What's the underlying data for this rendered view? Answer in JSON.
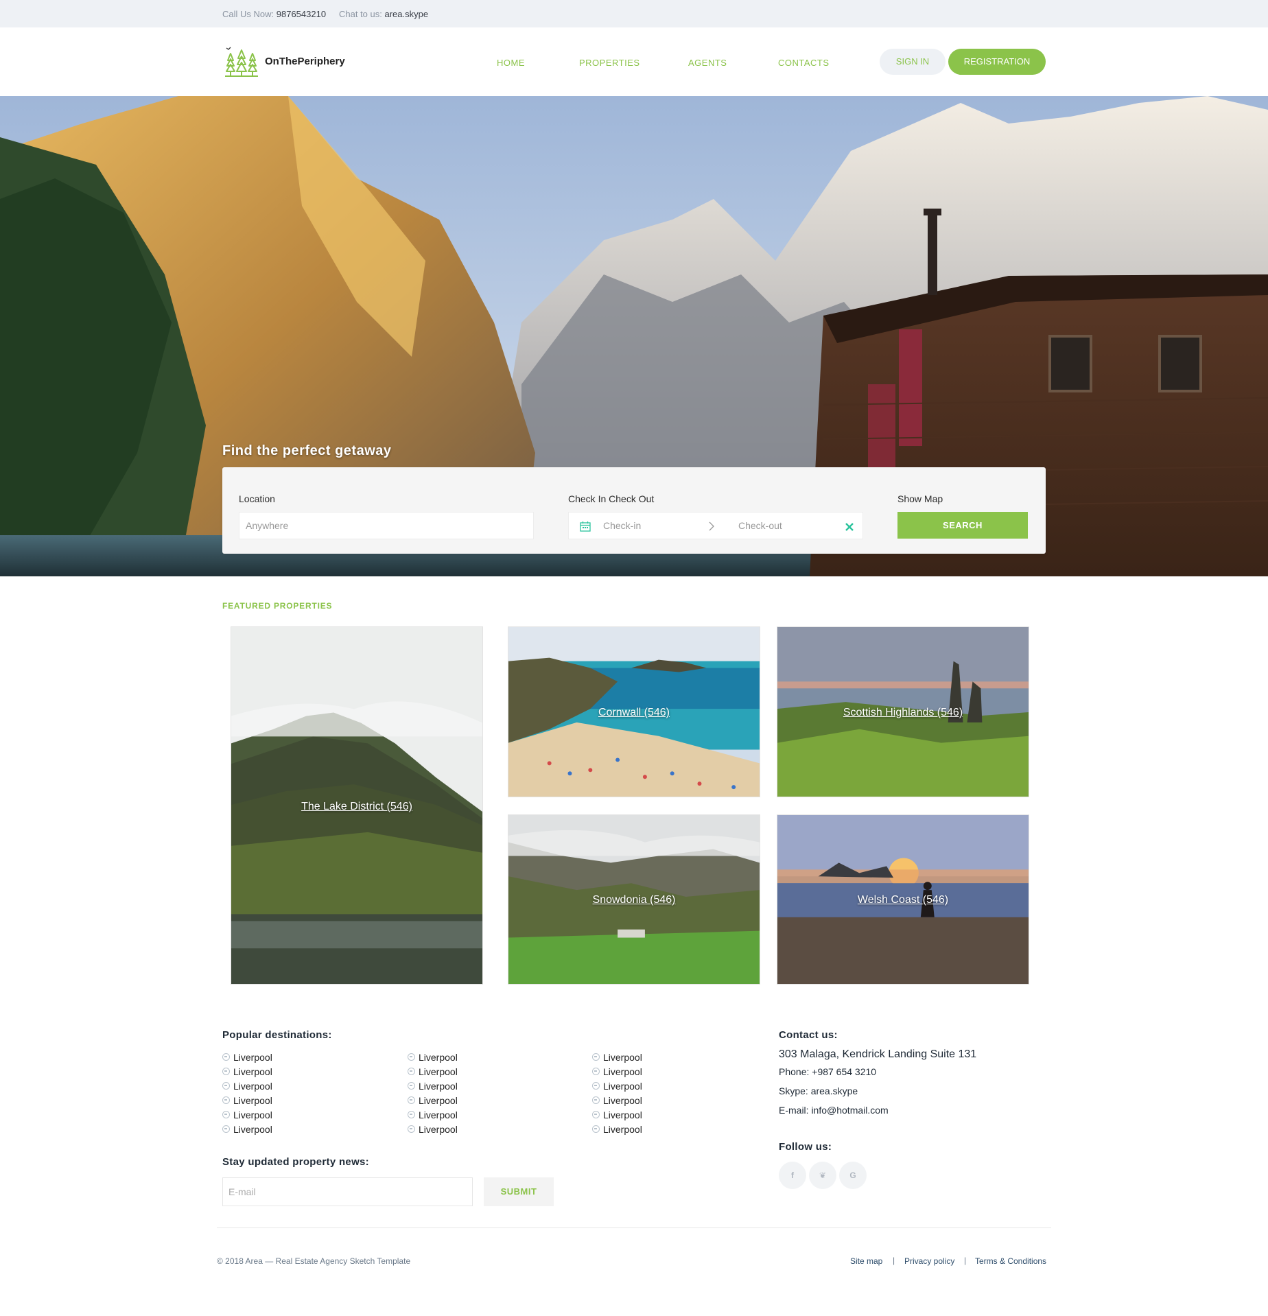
{
  "topbar": {
    "call_label": "Call Us Now:",
    "call_number": "9876543210",
    "chat_label": "Chat to us:",
    "chat_value": "area.skype"
  },
  "header": {
    "logo_text": "OnThePeriphery",
    "nav": [
      "HOME",
      "PROPERTIES",
      "AGENTS",
      "CONTACTS"
    ],
    "signin": "SIGN IN",
    "register": "REGISTRATION"
  },
  "hero": {
    "title": "Find the perfect getaway",
    "location_label": "Location",
    "location_placeholder": "Anywhere",
    "dates_label": "Check In Check Out",
    "checkin_placeholder": "Check-in",
    "checkout_placeholder": "Check-out",
    "map_label": "Show Map",
    "search_button": "SEARCH"
  },
  "featured": {
    "title": "FEATURED PROPERTIES",
    "cards": [
      {
        "name": "The Lake District (546)"
      },
      {
        "name": "Cornwall (546)"
      },
      {
        "name": "Scottish Highlands (546)"
      },
      {
        "name": "Snowdonia (546)"
      },
      {
        "name": "Welsh Coast (546)"
      }
    ]
  },
  "destinations": {
    "title": "Popular destinations:",
    "columns": [
      [
        "Liverpool",
        "Liverpool",
        "Liverpool",
        "Liverpool",
        "Liverpool",
        "Liverpool"
      ],
      [
        "Liverpool",
        "Liverpool",
        "Liverpool",
        "Liverpool",
        "Liverpool",
        "Liverpool"
      ],
      [
        "Liverpool",
        "Liverpool",
        "Liverpool",
        "Liverpool",
        "Liverpool",
        "Liverpool"
      ]
    ]
  },
  "newsletter": {
    "title": "Stay updated property news:",
    "placeholder": "E-mail",
    "submit": "SUBMIT"
  },
  "contact": {
    "title": "Contact us:",
    "address": "303 Malaga, Kendrick Landing Suite 131",
    "phone": "Phone: +987 654 3210",
    "skype": "Skype: area.skype",
    "email": "E-mail: info@hotmail.com",
    "follow_title": "Follow us:",
    "social": [
      "f",
      "❦",
      "G"
    ]
  },
  "footer": {
    "copyright": "© 2018 Area — Real Estate Agency Sketch Template",
    "links": [
      "Site map",
      "Privacy policy",
      "Terms & Conditions"
    ],
    "separator": "|"
  },
  "colors": {
    "accent": "#8bc34a",
    "topbar_bg": "#eef1f5"
  }
}
